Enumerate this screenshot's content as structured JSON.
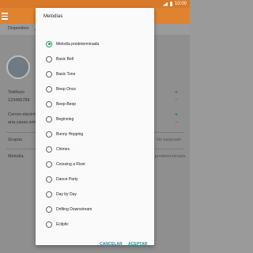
{
  "status": {
    "time": "10:00"
  },
  "background": {
    "dropdown_label": "Dispositivo",
    "phone_label": "Teléfono",
    "phone_value": "123456789",
    "email_label": "Correo electró",
    "email_value": "ana.casas.wm",
    "groups_label": "Grupos",
    "groups_value": "No asignado",
    "melody_label": "Melodía",
    "melody_value": "predeterminada"
  },
  "dialog": {
    "title": "Melodías",
    "options": [
      {
        "label": "Melodía predeterminada",
        "selected": true
      },
      {
        "label": "Basic Bell",
        "selected": false
      },
      {
        "label": "Basic Tone",
        "selected": false
      },
      {
        "label": "Beep Once",
        "selected": false
      },
      {
        "label": "Beep-Beep",
        "selected": false
      },
      {
        "label": "Beginning",
        "selected": false
      },
      {
        "label": "Bunny Hopping",
        "selected": false
      },
      {
        "label": "Chimes",
        "selected": false
      },
      {
        "label": "Crossing a River",
        "selected": false
      },
      {
        "label": "Dance Party",
        "selected": false
      },
      {
        "label": "Day by Day",
        "selected": false
      },
      {
        "label": "Drifting Downstream",
        "selected": false
      },
      {
        "label": "Ecliptic",
        "selected": false
      }
    ],
    "cancel_label": "CANCELAR",
    "accept_label": "ACEPTAR"
  },
  "colors": {
    "accent": "#e0832f",
    "radio": "#2e9a5a",
    "button_text": "#2b8a9e"
  }
}
